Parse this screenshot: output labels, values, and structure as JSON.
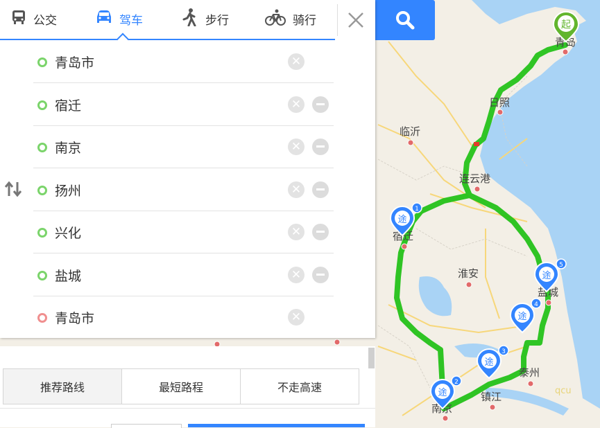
{
  "transport_modes": [
    {
      "label": "公交",
      "icon": "bus-icon",
      "active": false
    },
    {
      "label": "驾车",
      "icon": "car-icon",
      "active": true
    },
    {
      "label": "步行",
      "icon": "walk-icon",
      "active": false
    },
    {
      "label": "骑行",
      "icon": "bike-icon",
      "active": false
    }
  ],
  "waypoints": [
    {
      "name": "青岛市",
      "type": "start"
    },
    {
      "name": "宿迁",
      "type": "via"
    },
    {
      "name": "南京",
      "type": "via"
    },
    {
      "name": "扬州",
      "type": "via"
    },
    {
      "name": "兴化",
      "type": "via"
    },
    {
      "name": "盐城",
      "type": "via"
    },
    {
      "name": "青岛市",
      "type": "end"
    }
  ],
  "route_options": [
    "推荐路线",
    "最短路程",
    "不走高速"
  ],
  "map": {
    "city_labels": [
      "青岛",
      "日照",
      "临沂",
      "连云港",
      "宿迁",
      "淮安",
      "盐城",
      "泰州",
      "镇江",
      "南京"
    ],
    "start_marker": "起",
    "via_marker": "途",
    "via_numbers": [
      "1",
      "2",
      "3",
      "4",
      "5"
    ],
    "watermark": "qcu",
    "colors": {
      "route": "#25c21a",
      "sea": "#a9d3f5",
      "land": "#f3efe6",
      "accent": "#3385ff",
      "via_marker": "#3385ff",
      "start_marker": "#62b52d"
    }
  }
}
